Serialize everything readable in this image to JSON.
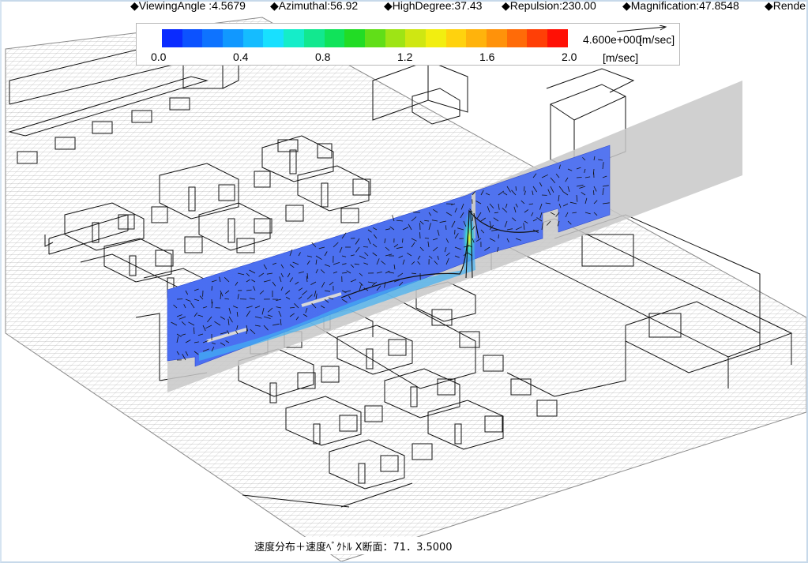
{
  "status": {
    "viewing_angle": "◆ViewingAngle :4.5679",
    "azimuthal": "◆Azimuthal:56.92",
    "high_degree": "◆HighDegree:37.43",
    "repulsion": "◆Repulsion:230.00",
    "magnification": "◆Magnification:47.8548",
    "render": "◆Rende"
  },
  "legend": {
    "tick_labels": [
      "0.0",
      "0.4",
      "0.8",
      "1.2",
      "1.6",
      "2.0"
    ],
    "unit": "[m/sec]",
    "vector_scale_value": "4.600e+000",
    "vector_scale_unit": "[m/sec]",
    "colors": [
      "#0a2bff",
      "#0c52ff",
      "#0e73ff",
      "#1198ff",
      "#15bcff",
      "#18e0ff",
      "#15edc9",
      "#12e88f",
      "#10e35a",
      "#22dc25",
      "#61de18",
      "#9ee415",
      "#cfe712",
      "#f2ee10",
      "#ffd20e",
      "#ffb30c",
      "#ff920a",
      "#ff6b08",
      "#ff3f06",
      "#ff1005"
    ]
  },
  "caption": "速度分布＋速度ﾍﾞｸﾄﾙ X断面：71．3.5000",
  "slice_colors": {
    "base": "#4f73f0",
    "dark": "#3a58e6",
    "high": "#3fe0e0",
    "jet": "#f0f020",
    "back_plane": "#c8c8c8"
  }
}
